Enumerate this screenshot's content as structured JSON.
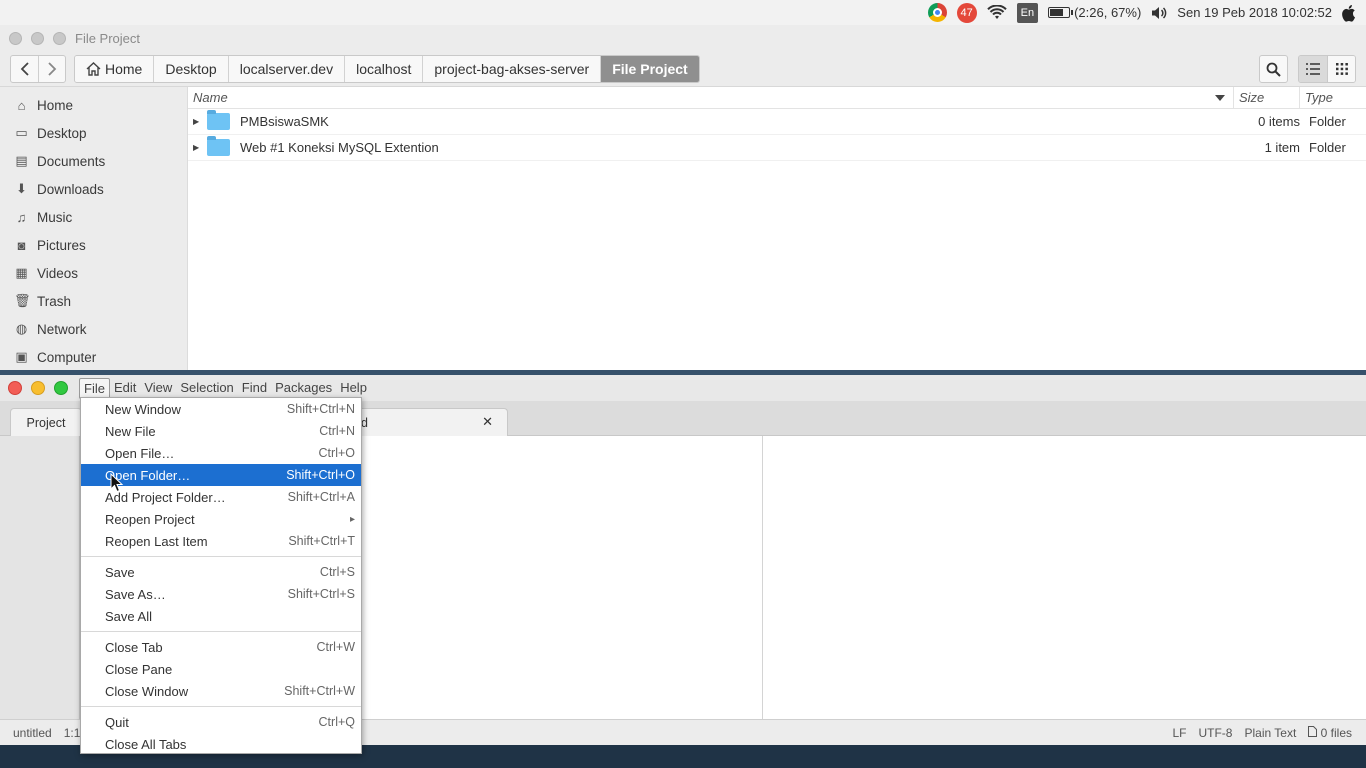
{
  "topbar": {
    "notification_count": "47",
    "language": "En",
    "battery_text": "(2:26, 67%)",
    "battery_level": 0.67,
    "datetime": "Sen 19 Peb 2018 10:02:52"
  },
  "file_manager": {
    "window_title": "File Project",
    "breadcrumbs": [
      "Home",
      "Desktop",
      "localserver.dev",
      "localhost",
      "project-bag-akses-server",
      "File Project"
    ],
    "sidebar": [
      {
        "label": "Home",
        "icon": "home-icon"
      },
      {
        "label": "Desktop",
        "icon": "desktop-icon"
      },
      {
        "label": "Documents",
        "icon": "documents-icon"
      },
      {
        "label": "Downloads",
        "icon": "downloads-icon"
      },
      {
        "label": "Music",
        "icon": "music-icon"
      },
      {
        "label": "Pictures",
        "icon": "pictures-icon"
      },
      {
        "label": "Videos",
        "icon": "videos-icon"
      },
      {
        "label": "Trash",
        "icon": "trash-icon"
      },
      {
        "label": "Network",
        "icon": "network-icon"
      },
      {
        "label": "Computer",
        "icon": "computer-icon"
      }
    ],
    "columns": {
      "name": "Name",
      "size": "Size",
      "type": "Type"
    },
    "rows": [
      {
        "name": "PMBsiswaSMK",
        "size": "0 items",
        "type": "Folder"
      },
      {
        "name": "Web #1 Koneksi MySQL Extention",
        "size": "1 item",
        "type": "Folder"
      }
    ]
  },
  "editor": {
    "menus": [
      "File",
      "Edit",
      "View",
      "Selection",
      "Find",
      "Packages",
      "Help"
    ],
    "tree_tab": "Project",
    "doc_tab_partial": "d",
    "status_left": [
      "untitled",
      "1:1"
    ],
    "status_right": [
      "LF",
      "UTF-8",
      "Plain Text",
      "0 files"
    ]
  },
  "file_menu": {
    "groups": [
      [
        {
          "label": "New Window",
          "shortcut": "Shift+Ctrl+N"
        },
        {
          "label": "New File",
          "shortcut": "Ctrl+N"
        },
        {
          "label": "Open File…",
          "shortcut": "Ctrl+O"
        },
        {
          "label": "Open Folder…",
          "shortcut": "Shift+Ctrl+O",
          "highlighted": true
        },
        {
          "label": "Add Project Folder…",
          "shortcut": "Shift+Ctrl+A"
        },
        {
          "label": "Reopen Project",
          "shortcut": "",
          "submenu": true
        },
        {
          "label": "Reopen Last Item",
          "shortcut": "Shift+Ctrl+T"
        }
      ],
      [
        {
          "label": "Save",
          "shortcut": "Ctrl+S"
        },
        {
          "label": "Save As…",
          "shortcut": "Shift+Ctrl+S"
        },
        {
          "label": "Save All",
          "shortcut": ""
        }
      ],
      [
        {
          "label": "Close Tab",
          "shortcut": "Ctrl+W"
        },
        {
          "label": "Close Pane",
          "shortcut": ""
        },
        {
          "label": "Close Window",
          "shortcut": "Shift+Ctrl+W"
        }
      ],
      [
        {
          "label": "Quit",
          "shortcut": "Ctrl+Q"
        },
        {
          "label": "Close All Tabs",
          "shortcut": ""
        }
      ]
    ]
  },
  "colors": {
    "menu_highlight": "#1c6fd1",
    "folder_blue": "#6ec3f4",
    "close_red": "#f25d56"
  }
}
